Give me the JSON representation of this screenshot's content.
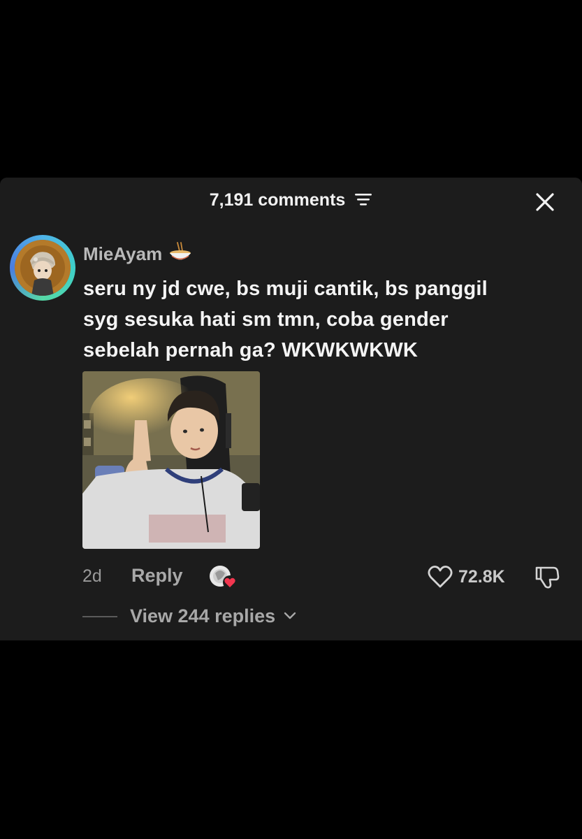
{
  "header": {
    "comments_label": "7,191 comments",
    "filter_icon": "filter-lines-icon",
    "close_icon": "close-x-icon"
  },
  "comment": {
    "username": "MieAyam",
    "username_emoji": "noodle-bowl-icon",
    "lines": [
      "seru ny jd cwe, bs muji cantik, bs panggil",
      "syg sesuka hati sm tmn, coba gender",
      "sebelah pernah ga? WKWKWKWK"
    ],
    "time_ago": "2d",
    "reply_label": "Reply",
    "like_count": "72.8K",
    "view_replies_label": "View 244 replies"
  },
  "colors": {
    "background": "#000000",
    "sheet": "#1c1c1c",
    "text_primary": "#f4f4f4",
    "text_secondary": "#a8a8a8",
    "heart_red": "#f2364f",
    "avatar_ring": "#4fb3e8"
  }
}
